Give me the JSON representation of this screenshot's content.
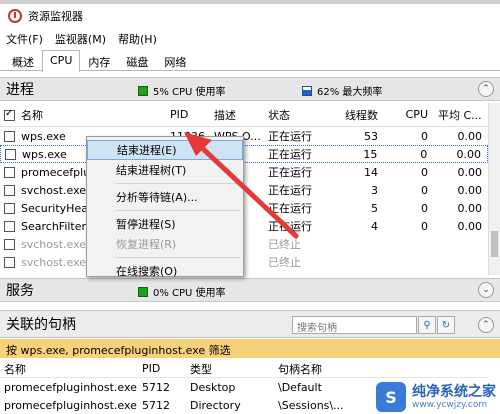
{
  "window": {
    "title": "资源监视器"
  },
  "menu": [
    "文件(F)",
    "监视器(M)",
    "帮助(H)"
  ],
  "tabs": [
    "概述",
    "CPU",
    "内存",
    "磁盘",
    "网络"
  ],
  "process_section": {
    "title": "进程",
    "cpu_stat": "5% CPU 使用率",
    "freq_stat": "62% 最大频率",
    "columns": [
      "名称",
      "PID",
      "描述",
      "状态",
      "线程数",
      "CPU",
      "平均 C..."
    ],
    "rows": [
      {
        "name": "wps.exe",
        "pid": "11836",
        "desc": "WPS O...",
        "status": "正在运行",
        "threads": "53",
        "cpu": "0",
        "avg": "0.00"
      },
      {
        "name": "wps.exe",
        "pid": "",
        "desc": "O...",
        "status": "正在运行",
        "threads": "15",
        "cpu": "0",
        "avg": "0.00"
      },
      {
        "name": "promecefplu",
        "pid": "",
        "desc": "",
        "status": "正在运行",
        "threads": "14",
        "cpu": "0",
        "avg": "0.00"
      },
      {
        "name": "svchost.exe (",
        "pid": "",
        "desc": "",
        "status": "正在运行",
        "threads": "3",
        "cpu": "0",
        "avg": "0.00"
      },
      {
        "name": "SecurityHealt",
        "pid": "",
        "desc": "",
        "status": "正在运行",
        "threads": "5",
        "cpu": "0",
        "avg": "0.00"
      },
      {
        "name": "SearchFilterH",
        "pid": "",
        "desc": "",
        "status": "正在运行",
        "threads": "4",
        "cpu": "0",
        "avg": "0.00"
      },
      {
        "name": "svchost.exe (",
        "pid": "",
        "desc": "",
        "status": "已终止",
        "threads": "",
        "cpu": "",
        "avg": ""
      },
      {
        "name": "svchost.exe (",
        "pid": "",
        "desc": "",
        "status": "已终止",
        "threads": "",
        "cpu": "",
        "avg": ""
      }
    ]
  },
  "context_menu": [
    "结束进程(E)",
    "结束进程树(T)",
    "分析等待链(A)...",
    "暂停进程(S)",
    "恢复进程(R)",
    "在线搜索(O)"
  ],
  "service_section": {
    "title": "服务",
    "cpu_stat": "0% CPU 使用率"
  },
  "handles_section": {
    "title": "关联的句柄",
    "search_placeholder": "搜索句柄",
    "filter_text": "按 wps.exe, promecefpluginhost.exe 筛选",
    "columns": [
      "名称",
      "PID",
      "类型",
      "句柄名称"
    ],
    "rows": [
      {
        "name": "promecefpluginhost.exe",
        "pid": "5712",
        "type": "Desktop",
        "handle": "\\Default"
      },
      {
        "name": "promecefpluginhost.exe",
        "pid": "5712",
        "type": "Directory",
        "handle": "\\Sessions\\..."
      }
    ]
  },
  "watermark": {
    "brand": "纯净系统之家",
    "url": "www.ycwjzy.com"
  },
  "colors": {
    "arrow": "#e53935",
    "highlight": "#cfe3f7",
    "filter_bar": "#f7d27a",
    "cpu_green": "#20a020"
  }
}
